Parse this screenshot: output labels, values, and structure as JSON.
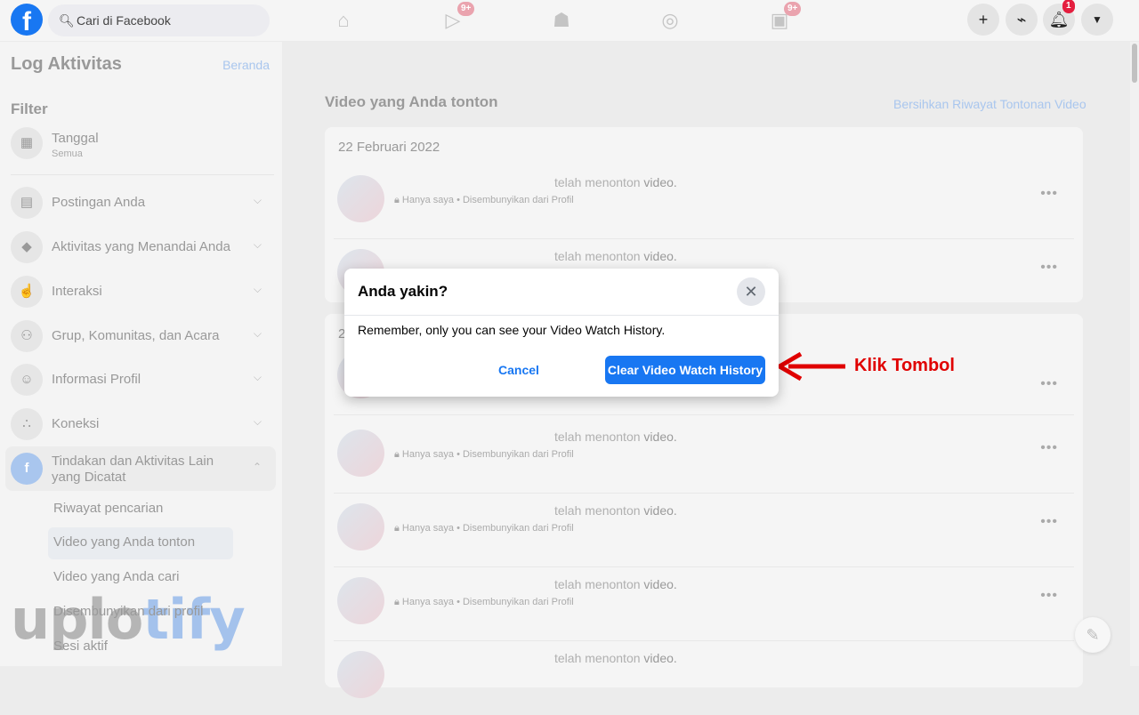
{
  "topbar": {
    "search_placeholder": "Cari di Facebook",
    "watch_badge": "9+",
    "gaming_badge": "9+",
    "notif_badge": "1"
  },
  "sidebar": {
    "title": "Log Aktivitas",
    "home_link": "Beranda",
    "filter_label": "Filter",
    "date_filter": {
      "label": "Tanggal",
      "value": "Semua"
    },
    "items": [
      {
        "label": "Postingan Anda",
        "icon": "post-icon"
      },
      {
        "label": "Aktivitas yang Menandai Anda",
        "icon": "tag-icon"
      },
      {
        "label": "Interaksi",
        "icon": "thumbs-up-icon"
      },
      {
        "label": "Grup, Komunitas, dan Acara",
        "icon": "group-icon"
      },
      {
        "label": "Informasi Profil",
        "icon": "profile-icon"
      },
      {
        "label": "Koneksi",
        "icon": "connections-icon"
      },
      {
        "label": "Tindakan dan Aktivitas Lain yang Dicatat",
        "icon": "facebook-icon"
      }
    ],
    "subitems": [
      "Riwayat pencarian",
      "Video yang Anda tonton",
      "Video yang Anda cari",
      "Disembunyikan dari profil",
      "Sesi aktif"
    ]
  },
  "main": {
    "title": "Video yang Anda tonton",
    "clear_link": "Bersihkan Riwayat Tontonan Video",
    "group1_date": "22 Februari 2022",
    "group2_date": "2",
    "row_text": "telah menonton",
    "row_text_bold": "video.",
    "row_privacy": "Hanya saya",
    "row_hidden": "Disembunyikan dari Profil"
  },
  "dialog": {
    "title": "Anda yakin?",
    "message": "Remember, only you can see your Video Watch History.",
    "cancel": "Cancel",
    "confirm": "Clear Video Watch History"
  },
  "annotation": {
    "text": "Klik Tombol",
    "color": "#e00000"
  },
  "watermark": {
    "text": "uplotify"
  },
  "colors": {
    "accent": "#1877f2"
  }
}
